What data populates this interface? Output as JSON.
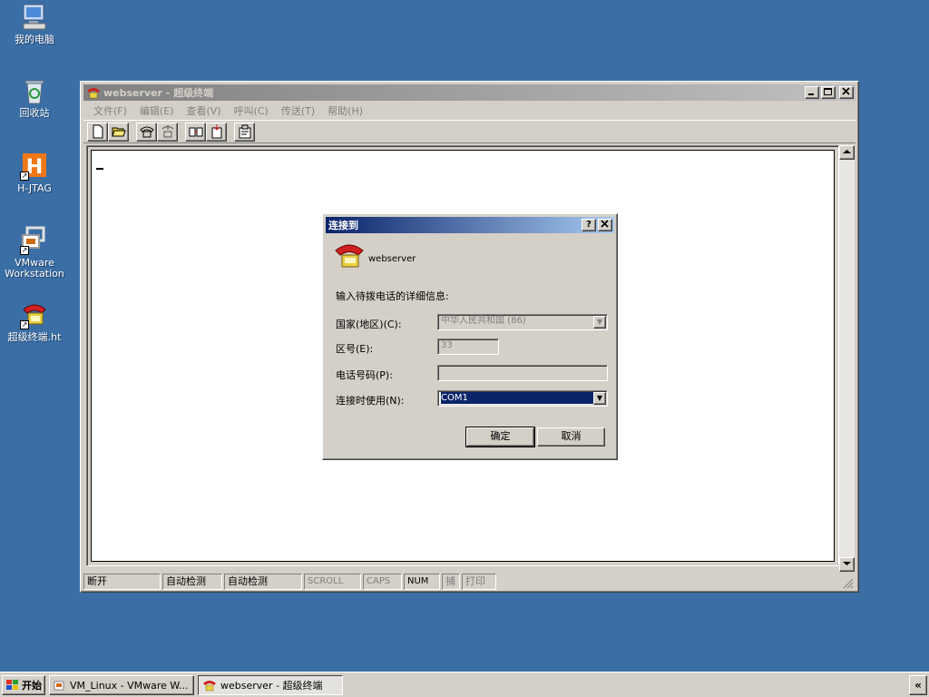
{
  "desktop": {
    "icons": [
      {
        "label": "我的电脑"
      },
      {
        "label": "回收站"
      },
      {
        "label": "H-JTAG"
      },
      {
        "label": "VMware Workstation"
      },
      {
        "label": "超级终端.ht"
      }
    ]
  },
  "window": {
    "title": "webserver - 超级终端",
    "menu": [
      "文件(F)",
      "编辑(E)",
      "查看(V)",
      "呼叫(C)",
      "传送(T)",
      "帮助(H)"
    ],
    "status": [
      "断开",
      "自动检测",
      "自动检测",
      "SCROLL",
      "CAPS",
      "NUM",
      "捕",
      "打印"
    ]
  },
  "dialog": {
    "title": "连接到",
    "help_button": "?",
    "close_button": "×",
    "connection_name": "webserver",
    "prompt": "输入待拨电话的详细信息:",
    "country_label": "国家(地区)(C):",
    "country_value": "中华人民共和国 (86)",
    "area_label": "区号(E):",
    "area_value": "33",
    "phone_label": "电话号码(P):",
    "phone_value": "",
    "connect_label": "连接时使用(N):",
    "connect_value": "COM1",
    "ok": "确定",
    "cancel": "取消"
  },
  "taskbar": {
    "start": "开始",
    "tasks": [
      "VM_Linux - VMware W...",
      "webserver - 超级终端"
    ],
    "tray": "«"
  },
  "colors": {
    "desktop": "#3a6ea5",
    "active_title_start": "#0a246a",
    "active_title_end": "#a6caf0",
    "face": "#d4d0c8",
    "selection": "#0a246a"
  }
}
